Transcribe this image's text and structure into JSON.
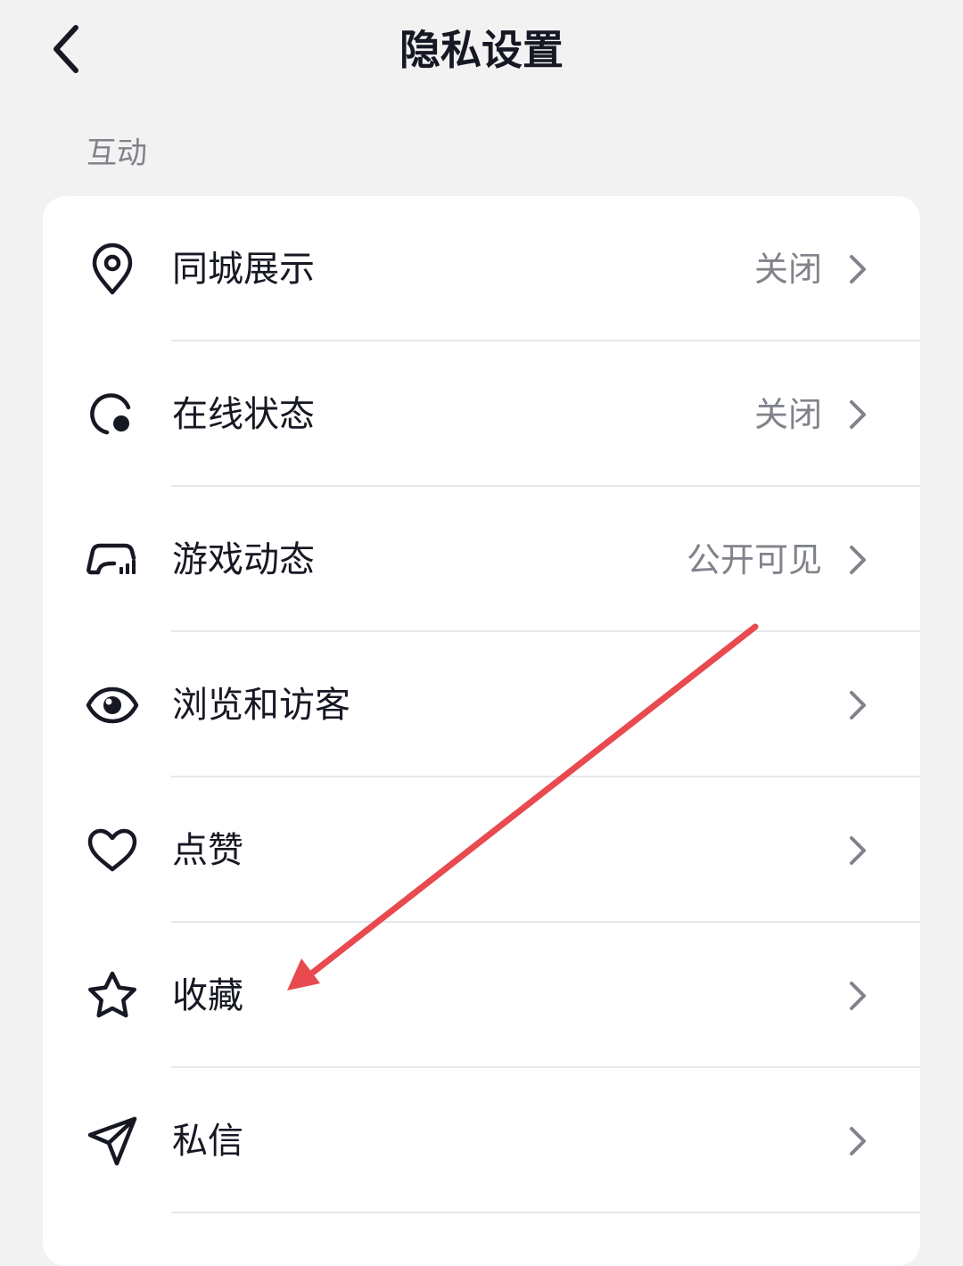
{
  "header": {
    "title": "隐私设置",
    "back_icon": "chevron-left-icon"
  },
  "section": {
    "title": "互动"
  },
  "items": [
    {
      "label": "同城展示",
      "value": "关闭",
      "icon": "location-pin-icon"
    },
    {
      "label": "在线状态",
      "value": "关闭",
      "icon": "online-status-icon"
    },
    {
      "label": "游戏动态",
      "value": "公开可见",
      "icon": "game-controller-icon"
    },
    {
      "label": "浏览和访客",
      "value": "",
      "icon": "eye-icon"
    },
    {
      "label": "点赞",
      "value": "",
      "icon": "heart-icon"
    },
    {
      "label": "收藏",
      "value": "",
      "icon": "star-icon"
    },
    {
      "label": "私信",
      "value": "",
      "icon": "send-icon"
    }
  ],
  "annotation": {
    "arrow_color": "#e84a4f"
  },
  "colors": {
    "background": "#f2f2f3",
    "card": "#ffffff",
    "text_primary": "#161823",
    "text_secondary": "#80838a"
  }
}
